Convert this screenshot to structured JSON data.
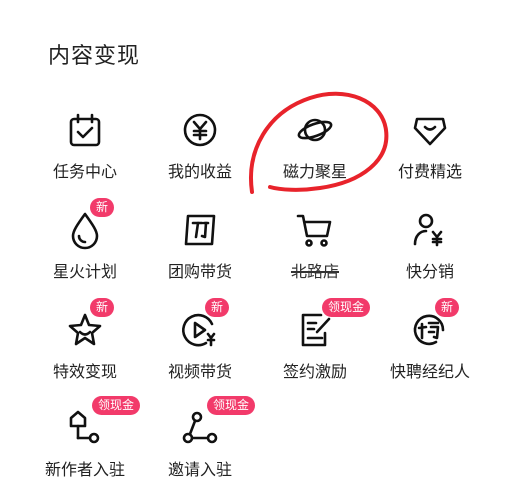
{
  "section": {
    "title": "内容变现"
  },
  "items": [
    {
      "label": "任务中心",
      "icon": "calendar-check-icon"
    },
    {
      "label": "我的收益",
      "icon": "yen-coin-icon"
    },
    {
      "label": "磁力聚星",
      "icon": "planet-icon"
    },
    {
      "label": "付费精选",
      "icon": "diamond-icon"
    },
    {
      "label": "星火计划",
      "icon": "water-drop-icon",
      "badge": "新"
    },
    {
      "label": "团购带货",
      "icon": "group-buy-icon"
    },
    {
      "label": "北路店",
      "icon": "shopping-cart-icon"
    },
    {
      "label": "快分销",
      "icon": "user-yen-icon"
    },
    {
      "label": "特效变现",
      "icon": "sparkle-star-icon",
      "badge": "新"
    },
    {
      "label": "视频带货",
      "icon": "video-yen-icon",
      "badge": "新"
    },
    {
      "label": "签约激励",
      "icon": "contract-pen-icon",
      "badge": "领现金"
    },
    {
      "label": "快聘经纪人",
      "icon": "recruit-icon",
      "badge": "新"
    },
    {
      "label": "新作者入驻",
      "icon": "new-author-icon",
      "badge": "领现金"
    },
    {
      "label": "邀请入驻",
      "icon": "invite-share-icon",
      "badge": "领现金"
    }
  ],
  "colors": {
    "badge": "#f23a6a",
    "annotation": "#e8232b",
    "text": "#222222"
  }
}
